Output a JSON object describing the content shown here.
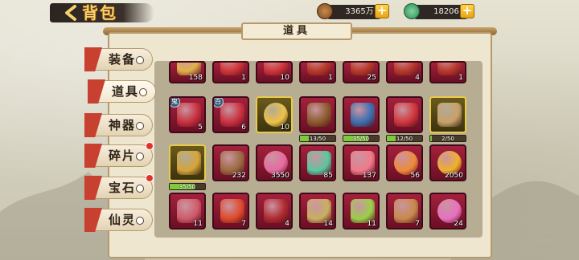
{
  "header": {
    "title": "背包",
    "coins": "3365万",
    "jade": "18206"
  },
  "panel": {
    "title": "道具"
  },
  "tabs": [
    {
      "label": "装备",
      "active": false,
      "badge": false
    },
    {
      "label": "道具",
      "active": true,
      "badge": false
    },
    {
      "label": "神器",
      "active": false,
      "badge": false
    },
    {
      "label": "碎片",
      "active": false,
      "badge": true
    },
    {
      "label": "宝石",
      "active": false,
      "badge": true
    },
    {
      "label": "仙灵",
      "active": false,
      "badge": false
    }
  ],
  "rows": [
    [
      {
        "name": "lantern",
        "count": "158",
        "frame": "red"
      },
      {
        "name": "gift-chest",
        "count": "1",
        "frame": "red"
      },
      {
        "name": "gift-chest",
        "count": "10",
        "frame": "red"
      },
      {
        "name": "chest",
        "count": "1",
        "frame": "red"
      },
      {
        "name": "chest",
        "count": "25",
        "frame": "red"
      },
      {
        "name": "chest",
        "count": "4",
        "frame": "red"
      },
      {
        "name": "chest",
        "count": "1",
        "frame": "red"
      }
    ],
    [
      {
        "name": "red-package",
        "count": "5",
        "frame": "red",
        "tag": "鬼"
      },
      {
        "name": "red-package",
        "count": "6",
        "frame": "red",
        "tag": "百"
      },
      {
        "name": "golden-egg",
        "count": "10",
        "frame": "gold"
      },
      {
        "name": "mystery-chest",
        "count": "",
        "frame": "red",
        "progress": "13/50",
        "pct": 0.26
      },
      {
        "name": "treasure-chest",
        "count": "",
        "frame": "red",
        "progress": "35/50",
        "pct": 0.7
      },
      {
        "name": "gift-chest",
        "count": "",
        "frame": "red",
        "progress": "12/50",
        "pct": 0.24
      },
      {
        "name": "food-box",
        "count": "",
        "frame": "gold",
        "progress": "2/50",
        "pct": 0.04
      }
    ],
    [
      {
        "name": "treasure-box",
        "count": "",
        "frame": "gold",
        "progress": "35/50",
        "pct": 0.7
      },
      {
        "name": "horn",
        "count": "232",
        "frame": "red"
      },
      {
        "name": "pink-gem",
        "count": "3550",
        "frame": "red"
      },
      {
        "name": "tea-bowl",
        "count": "85",
        "frame": "red"
      },
      {
        "name": "feather",
        "count": "137",
        "frame": "red"
      },
      {
        "name": "swirl-candy",
        "count": "56",
        "frame": "red"
      },
      {
        "name": "gold-coin",
        "count": "2050",
        "frame": "red"
      }
    ],
    [
      {
        "name": "elixir",
        "count": "11",
        "frame": "red"
      },
      {
        "name": "dragon",
        "count": "7",
        "frame": "red"
      },
      {
        "name": "red-envelope",
        "count": "4",
        "frame": "red"
      },
      {
        "name": "star-medal",
        "count": "14",
        "frame": "red"
      },
      {
        "name": "green-dumplings",
        "count": "11",
        "frame": "red"
      },
      {
        "name": "bento",
        "count": "7",
        "frame": "red"
      },
      {
        "name": "heart-orb",
        "count": "24",
        "frame": "red"
      }
    ]
  ],
  "colors": {
    "slot_red": "#8e1a33",
    "slot_gold": "#e8cb4a",
    "progress_green": "#7ccb3b"
  }
}
